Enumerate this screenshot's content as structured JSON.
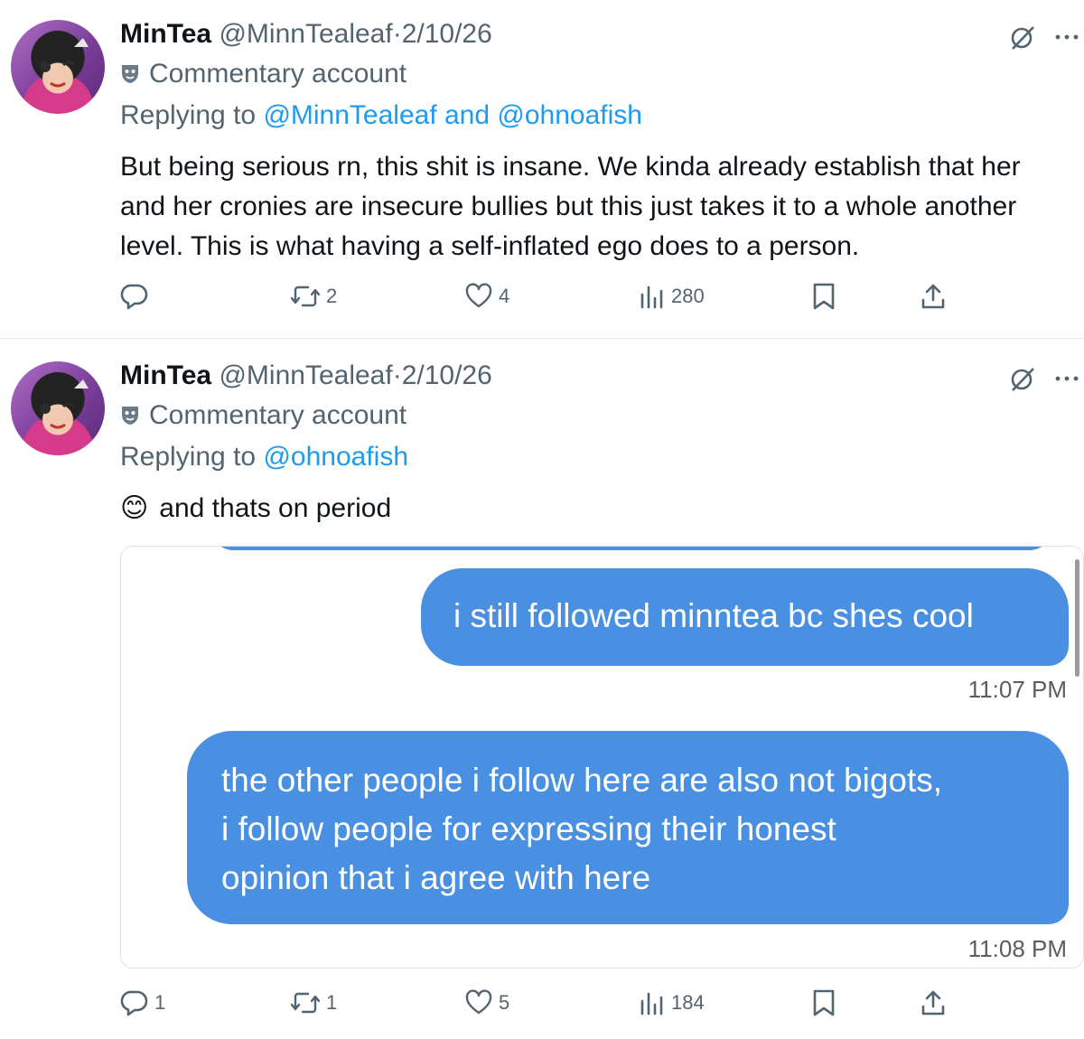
{
  "tweets": [
    {
      "name": "MinTea",
      "handle": "@MinnTealeaf",
      "separator": "·",
      "date": "2/10/26",
      "account_label": "Commentary account",
      "replying_prefix": "Replying to ",
      "replying_targets": "@MinnTealeaf and @ohnoafish",
      "text": "But being serious rn, this shit is insane. We kinda already establish that her and her cronies are insecure bullies but this just takes it to a whole another level. This is what having a self-inflated ego does to a person.",
      "stats": {
        "replies": "",
        "reposts": "2",
        "likes": "4",
        "views": "280"
      }
    },
    {
      "name": "MinTea",
      "handle": "@MinnTealeaf",
      "separator": "·",
      "date": "2/10/26",
      "account_label": "Commentary account",
      "replying_prefix": "Replying to ",
      "replying_targets": "@ohnoafish",
      "emoji": "😊",
      "text": "and thats on period",
      "stats": {
        "replies": "1",
        "reposts": "1",
        "likes": "5",
        "views": "184"
      },
      "media": {
        "messages": [
          {
            "text": "i still followed minntea bc shes cool",
            "time": "11:07 PM"
          },
          {
            "lines": [
              "the other people i follow here are also not bigots,",
              "i follow people for expressing their honest",
              "opinion that i agree with here"
            ],
            "time": "11:08 PM"
          }
        ]
      }
    }
  ],
  "colors": {
    "link": "#1d9bf0",
    "muted": "#536471",
    "bubble": "#4a90e2"
  },
  "icons": [
    "grok-icon",
    "more-icon",
    "reply-icon",
    "repost-icon",
    "like-icon",
    "views-icon",
    "bookmark-icon",
    "share-icon",
    "commentary-mask-icon"
  ]
}
